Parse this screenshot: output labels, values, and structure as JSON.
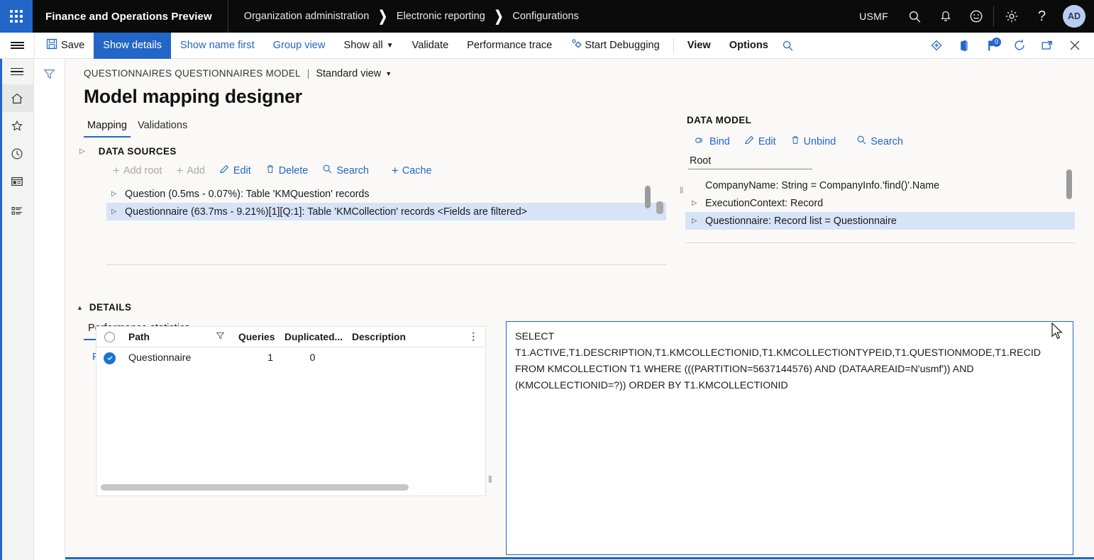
{
  "topbar": {
    "app_title": "Finance and Operations Preview",
    "breadcrumbs": [
      "Organization administration",
      "Electronic reporting",
      "Configurations"
    ],
    "company": "USMF",
    "icons": [
      "search-icon",
      "notification-bell-icon",
      "feedback-smiley-icon",
      "settings-gear-icon",
      "help-question-icon"
    ],
    "avatar_initials": "AD",
    "accent_color": "#2266c8"
  },
  "toolbar": {
    "save_label": "Save",
    "items": [
      {
        "label": "Show details",
        "state": "active"
      },
      {
        "label": "Show name first",
        "state": "link"
      },
      {
        "label": "Group view",
        "state": "link"
      },
      {
        "label": "Show all",
        "state": "dropdown"
      },
      {
        "label": "Validate",
        "state": "plain"
      },
      {
        "label": "Performance trace",
        "state": "plain"
      },
      {
        "label": "Start Debugging",
        "state": "icon"
      },
      {
        "label": "View",
        "state": "bold"
      },
      {
        "label": "Options",
        "state": "bold"
      }
    ],
    "search_icon": "search-icon",
    "right_icons": [
      "share-diamond-icon",
      "open-in-office-icon",
      "power-apps-icon",
      "refresh-icon",
      "popout-icon",
      "close-icon"
    ],
    "power_apps_badge": "0"
  },
  "rail": {
    "items": [
      "home-icon",
      "favorites-star-icon",
      "recent-clock-icon",
      "workspaces-icon",
      "modules-list-icon"
    ]
  },
  "filter_pane": {
    "icon": "filter-funnel-icon"
  },
  "page": {
    "breadcrumb": "QUESTIONNAIRES QUESTIONNAIRES MODEL",
    "separator": "|",
    "view_selector": "Standard view",
    "title": "Model mapping designer",
    "tabs": [
      {
        "label": "Mapping",
        "selected": true
      },
      {
        "label": "Validations",
        "selected": false
      }
    ]
  },
  "data_sources": {
    "title": "DATA SOURCES",
    "commands": [
      {
        "label": "Add root",
        "icon": "plus-icon",
        "disabled": true
      },
      {
        "label": "Add",
        "icon": "plus-icon",
        "disabled": true
      },
      {
        "label": "Edit",
        "icon": "pencil-icon",
        "disabled": false
      },
      {
        "label": "Delete",
        "icon": "trash-icon",
        "disabled": false
      },
      {
        "label": "Search",
        "icon": "search-icon",
        "disabled": false
      },
      {
        "label": "Cache",
        "icon": "plus-icon",
        "disabled": false
      }
    ],
    "rows": [
      {
        "text": "Question (0.5ms - 0.07%): Table 'KMQuestion' records",
        "selected": false
      },
      {
        "text": "Questionnaire (63.7ms - 9.21%)[1][Q:1]: Table 'KMCollection' records <Fields are filtered>",
        "selected": true
      }
    ]
  },
  "data_model": {
    "title": "DATA MODEL",
    "commands": [
      {
        "label": "Bind",
        "icon": "link-bind-icon"
      },
      {
        "label": "Edit",
        "icon": "pencil-icon"
      },
      {
        "label": "Unbind",
        "icon": "trash-icon"
      },
      {
        "label": "Search",
        "icon": "search-icon"
      }
    ],
    "root_value": "Root",
    "root_placeholder": "Root",
    "rows": [
      {
        "text": "CompanyName: String = CompanyInfo.'find()'.Name",
        "selected": false,
        "expandable": false
      },
      {
        "text": "ExecutionContext: Record",
        "selected": false,
        "expandable": true
      },
      {
        "text": "Questionnaire: Record list = Questionnaire",
        "selected": true,
        "expandable": true
      }
    ]
  },
  "details": {
    "title": "DETAILS",
    "tab": "Performance statistics",
    "find_link": "Find in tree",
    "grid": {
      "columns": [
        "Path",
        "Queries",
        "Duplicated...",
        "Description"
      ],
      "filter_icon": "filter-funnel-icon",
      "overflow_icon": "more-vertical-icon",
      "rows": [
        {
          "selected": true,
          "path": "Questionnaire",
          "queries": "1",
          "duplicated": "0",
          "description": ""
        }
      ]
    },
    "sql": "SELECT\nT1.ACTIVE,T1.DESCRIPTION,T1.KMCOLLECTIONID,T1.KMCOLLECTIONTYPEID,T1.QUESTIONMODE,T1.RECID FROM KMCOLLECTION T1 WHERE (((PARTITION=5637144576) AND (DATAAREAID=N'usmf')) AND (KMCOLLECTIONID=?)) ORDER BY T1.KMCOLLECTIONID"
  }
}
